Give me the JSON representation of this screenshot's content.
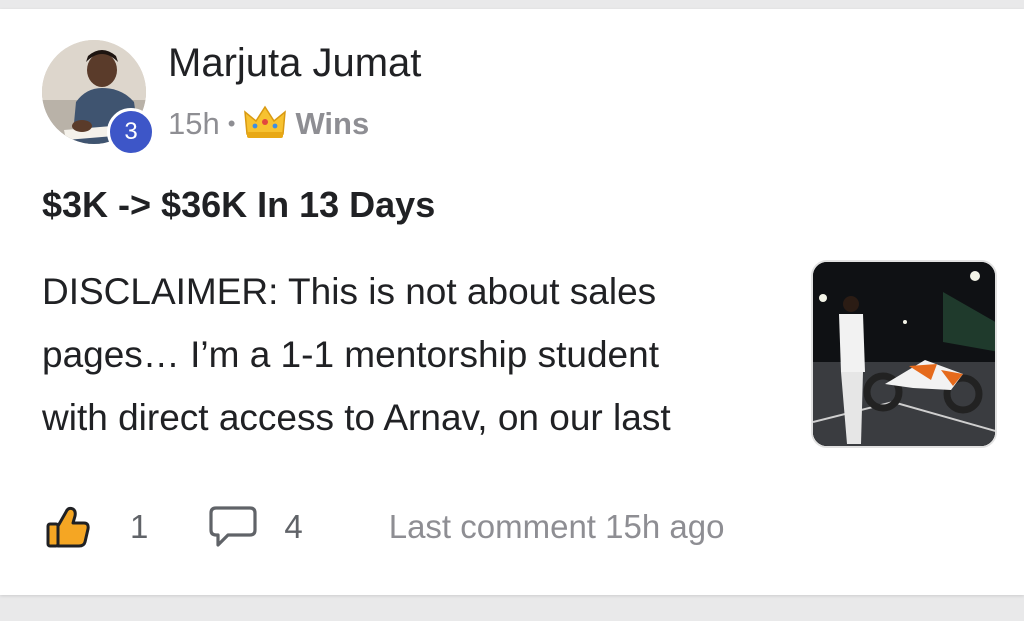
{
  "post": {
    "author": {
      "name": "Marjuta Jumat",
      "level": "3"
    },
    "time": "15h",
    "separator": "•",
    "category": "Wins",
    "category_icon": "crown-icon",
    "title": "$3K -> $36K In 13 Days",
    "excerpt_lines": [
      "DISCLAIMER: This is not about sales",
      "pages… I’m a 1-1 mentorship student",
      "with direct access to Arnav, on our last"
    ],
    "likes": "1",
    "comments": "4",
    "last_comment": "Last comment 15h ago"
  },
  "colors": {
    "level_badge": "#3d56c8",
    "like_icon": "#f5a623",
    "muted_text": "#8e8e93"
  }
}
